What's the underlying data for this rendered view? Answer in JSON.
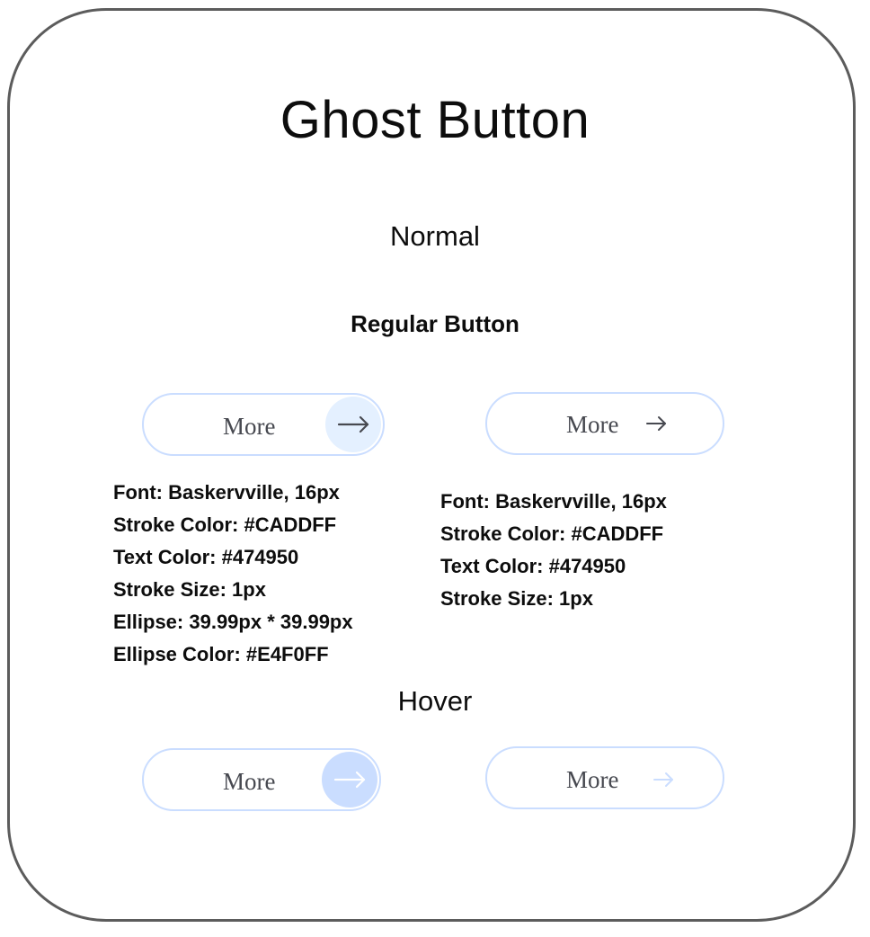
{
  "title": "Ghost Button",
  "sections": {
    "normal": "Normal",
    "regular_button": "Regular Button",
    "hover": "Hover"
  },
  "buttons": {
    "label": "More",
    "arrow_icon": "arrow-right-icon"
  },
  "colors": {
    "stroke": "#CADDFF",
    "text": "#474950",
    "ellipse": "#E4F0FF",
    "ellipse_hover": "#CADDFF",
    "frame": "#5c5c5c"
  },
  "specs": {
    "left": [
      "Font: Baskervville, 16px",
      "Stroke Color: #CADDFF",
      "Text Color: #474950",
      "Stroke Size: 1px",
      "Ellipse: 39.99px * 39.99px",
      "Ellipse Color: #E4F0FF"
    ],
    "right": [
      "Font: Baskervville, 16px",
      "Stroke Color: #CADDFF",
      "Text Color: #474950",
      "Stroke Size: 1px"
    ]
  }
}
